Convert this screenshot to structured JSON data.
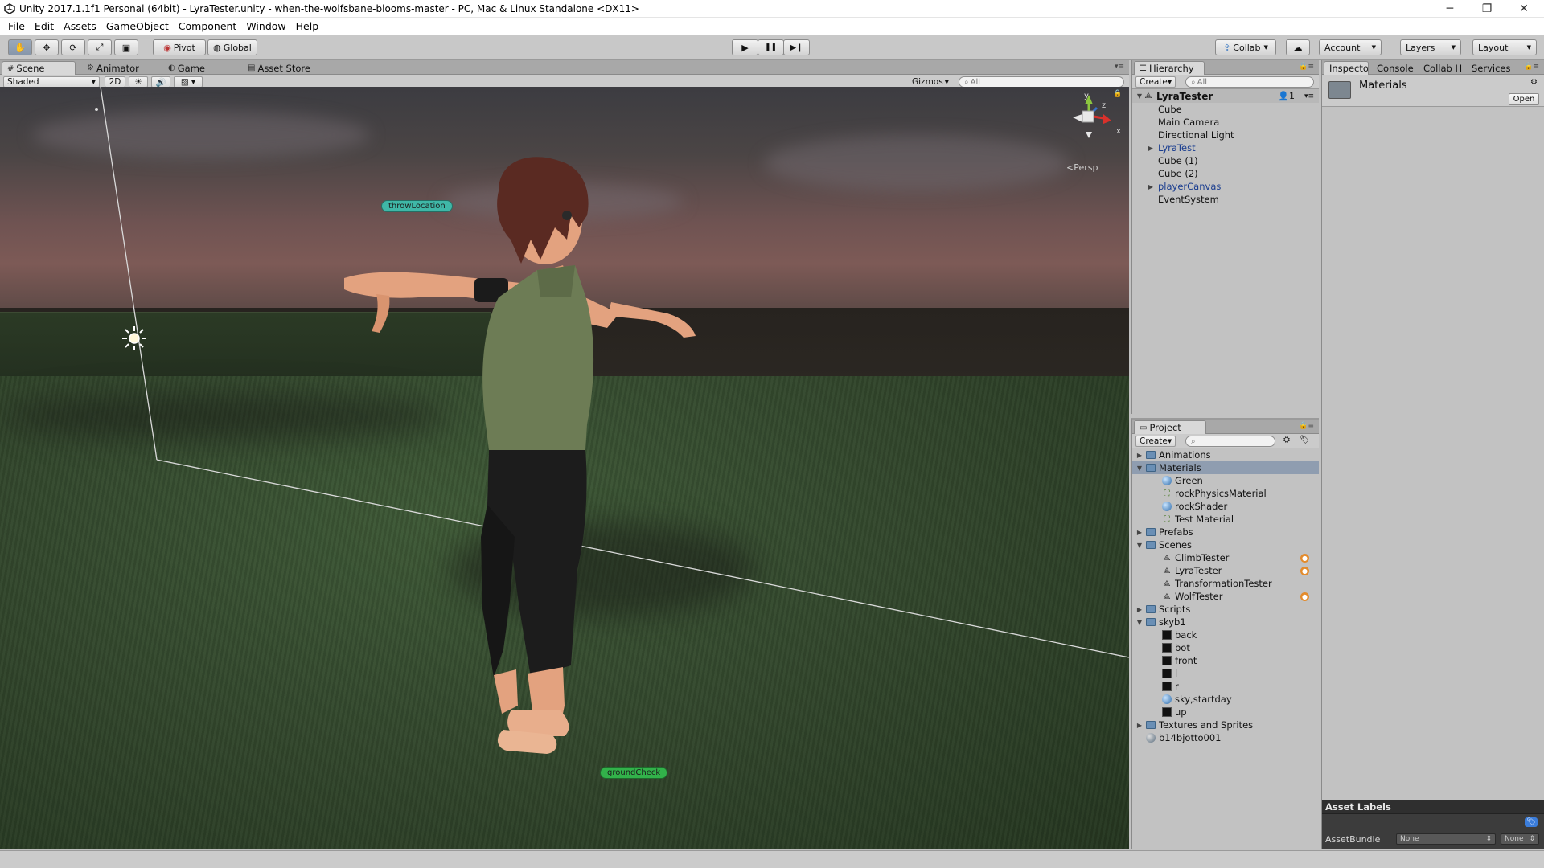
{
  "window": {
    "title": "Unity 2017.1.1f1 Personal (64bit) - LyraTester.unity - when-the-wolfsbane-blooms-master - PC, Mac & Linux Standalone <DX11>",
    "minimize": "─",
    "maximize": "❐",
    "close": "✕"
  },
  "menu": [
    "File",
    "Edit",
    "Assets",
    "GameObject",
    "Component",
    "Window",
    "Help"
  ],
  "toolbar": {
    "pivot": "Pivot",
    "global": "Global",
    "play": "▶",
    "pause": "❚❚",
    "step": "▶❙",
    "collab": "Collab",
    "account": "Account",
    "layers": "Layers",
    "layout": "Layout"
  },
  "scene_panel": {
    "tabs": [
      "Scene",
      "Animator",
      "Game",
      "Asset Store"
    ],
    "shading": "Shaded",
    "mode_2d": "2D",
    "gizmos": "Gizmos",
    "search_placeholder": "All",
    "persp_label": "Persp",
    "gizmo_axes": {
      "y": "y",
      "z": "z",
      "x": "x"
    },
    "labels": {
      "throw": "throwLocation",
      "ground": "groundCheck"
    }
  },
  "hierarchy": {
    "tab": "Hierarchy",
    "create": "Create",
    "search_placeholder": "All",
    "scene": "LyraTester",
    "collab_count": "1",
    "items": [
      {
        "label": "Cube",
        "prefab": false,
        "fold": ""
      },
      {
        "label": "Main Camera",
        "prefab": false,
        "fold": ""
      },
      {
        "label": "Directional Light",
        "prefab": false,
        "fold": ""
      },
      {
        "label": "LyraTest",
        "prefab": true,
        "fold": "▶"
      },
      {
        "label": "Cube (1)",
        "prefab": false,
        "fold": ""
      },
      {
        "label": "Cube (2)",
        "prefab": false,
        "fold": ""
      },
      {
        "label": "playerCanvas",
        "prefab": true,
        "fold": "▶"
      },
      {
        "label": "EventSystem",
        "prefab": false,
        "fold": ""
      }
    ]
  },
  "project": {
    "tab": "Project",
    "create": "Create",
    "items": [
      {
        "label": "Animations",
        "icon": "folder",
        "depth": 0,
        "fold": "▶",
        "selected": false,
        "collab": false
      },
      {
        "label": "Materials",
        "icon": "folder",
        "depth": 0,
        "fold": "▼",
        "selected": true,
        "collab": false
      },
      {
        "label": "Green",
        "icon": "material",
        "depth": 1,
        "fold": "",
        "selected": false,
        "collab": false
      },
      {
        "label": "rockPhysicsMaterial",
        "icon": "physics",
        "depth": 1,
        "fold": "",
        "selected": false,
        "collab": false
      },
      {
        "label": "rockShader",
        "icon": "material",
        "depth": 1,
        "fold": "",
        "selected": false,
        "collab": false
      },
      {
        "label": "Test Material",
        "icon": "physics",
        "depth": 1,
        "fold": "",
        "selected": false,
        "collab": false
      },
      {
        "label": "Prefabs",
        "icon": "folder",
        "depth": 0,
        "fold": "▶",
        "selected": false,
        "collab": false
      },
      {
        "label": "Scenes",
        "icon": "folder",
        "depth": 0,
        "fold": "▼",
        "selected": false,
        "collab": false
      },
      {
        "label": "ClimbTester",
        "icon": "scene",
        "depth": 1,
        "fold": "",
        "selected": false,
        "collab": true
      },
      {
        "label": "LyraTester",
        "icon": "scene",
        "depth": 1,
        "fold": "",
        "selected": false,
        "collab": true
      },
      {
        "label": "TransformationTester",
        "icon": "scene",
        "depth": 1,
        "fold": "",
        "selected": false,
        "collab": false
      },
      {
        "label": "WolfTester",
        "icon": "scene",
        "depth": 1,
        "fold": "",
        "selected": false,
        "collab": true
      },
      {
        "label": "Scripts",
        "icon": "folder",
        "depth": 0,
        "fold": "▶",
        "selected": false,
        "collab": false
      },
      {
        "label": "skyb1",
        "icon": "folder",
        "depth": 0,
        "fold": "▼",
        "selected": false,
        "collab": false
      },
      {
        "label": "back",
        "icon": "texture",
        "depth": 1,
        "fold": "",
        "selected": false,
        "collab": false
      },
      {
        "label": "bot",
        "icon": "texture",
        "depth": 1,
        "fold": "",
        "selected": false,
        "collab": false
      },
      {
        "label": "front",
        "icon": "texture",
        "depth": 1,
        "fold": "",
        "selected": false,
        "collab": false
      },
      {
        "label": "l",
        "icon": "texture",
        "depth": 1,
        "fold": "",
        "selected": false,
        "collab": false
      },
      {
        "label": "r",
        "icon": "texture",
        "depth": 1,
        "fold": "",
        "selected": false,
        "collab": false
      },
      {
        "label": "sky,startday",
        "icon": "material",
        "depth": 1,
        "fold": "",
        "selected": false,
        "collab": false
      },
      {
        "label": "up",
        "icon": "texture",
        "depth": 1,
        "fold": "",
        "selected": false,
        "collab": false
      },
      {
        "label": "Textures and Sprites",
        "icon": "folder",
        "depth": 0,
        "fold": "▶",
        "selected": false,
        "collab": false
      },
      {
        "label": "b14bjotto001",
        "icon": "model",
        "depth": 0,
        "fold": "",
        "selected": false,
        "collab": false
      }
    ]
  },
  "inspector": {
    "tabs": [
      "Inspecto",
      "Console",
      "Collab H",
      "Services"
    ],
    "asset_name": "Materials",
    "open": "Open",
    "asset_labels": "Asset Labels",
    "assetbundle_label": "AssetBundle",
    "bundle_value": "None",
    "variant_value": "None"
  },
  "colors": {
    "selection": "#8f9db0",
    "prefab_text": "#1a3d8f",
    "collab_badge": "#e38b2c"
  }
}
